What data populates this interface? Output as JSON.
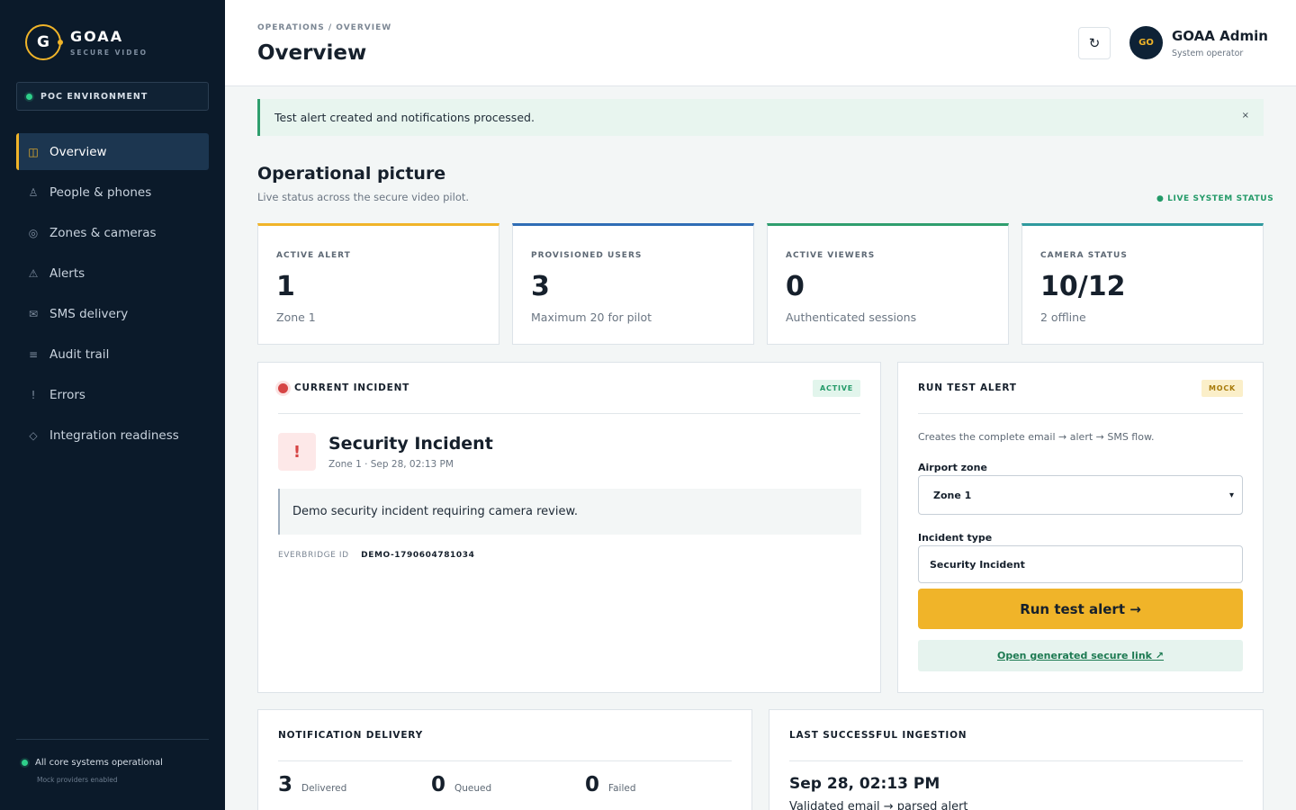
{
  "brand": {
    "mark": "G",
    "name": "GOAA",
    "sub": "SECURE VIDEO"
  },
  "environment": {
    "label": "POC ENVIRONMENT"
  },
  "nav": [
    {
      "label": "Overview",
      "icon": "◫"
    },
    {
      "label": "People & phones",
      "icon": "♙"
    },
    {
      "label": "Zones & cameras",
      "icon": "◎"
    },
    {
      "label": "Alerts",
      "icon": "⚠"
    },
    {
      "label": "SMS delivery",
      "icon": "✉"
    },
    {
      "label": "Audit trail",
      "icon": "≡"
    },
    {
      "label": "Errors",
      "icon": "!"
    },
    {
      "label": "Integration readiness",
      "icon": "◇"
    }
  ],
  "sidebar_footer": {
    "status": "All core systems operational",
    "note": "Mock providers enabled"
  },
  "header": {
    "breadcrumb": "OPERATIONS / OVERVIEW",
    "title": "Overview",
    "refresh_icon": "↻",
    "user": {
      "initials": "GO",
      "name": "GOAA Admin",
      "role": "System operator"
    }
  },
  "flash": {
    "message": "Test alert created and notifications processed.",
    "close": "×"
  },
  "section": {
    "title": "Operational picture",
    "subtitle": "Live status across the secure video pilot.",
    "live": "● LIVE SYSTEM STATUS"
  },
  "stats": [
    {
      "label": "ACTIVE ALERT",
      "value": "1",
      "note": "Zone 1",
      "color": "#f0b429"
    },
    {
      "label": "PROVISIONED USERS",
      "value": "3",
      "note": "Maximum 20 for pilot",
      "color": "#2f6db5"
    },
    {
      "label": "ACTIVE VIEWERS",
      "value": "0",
      "note": "Authenticated sessions",
      "color": "#2f9e6e"
    },
    {
      "label": "CAMERA STATUS",
      "value": "10/12",
      "note": "2 offline",
      "color": "#2f9a9e"
    }
  ],
  "incident": {
    "panel_title": "CURRENT INCIDENT",
    "badge": "ACTIVE",
    "icon": "!",
    "title": "Security Incident",
    "meta": "Zone 1 · Sep 28, 02:13 PM",
    "description": "Demo security incident requiring camera review.",
    "everbridge_label": "EVERBRIDGE ID",
    "everbridge_id": "DEMO-1790604781034"
  },
  "test_alert": {
    "panel_title": "RUN TEST ALERT",
    "badge": "MOCK",
    "description": "Creates the complete email → alert → SMS flow.",
    "zone_label": "Airport zone",
    "zone_value": "Zone 1",
    "type_label": "Incident type",
    "type_value": "Security Incident",
    "run_button": "Run test alert →",
    "open_link": "Open generated secure link ↗"
  },
  "notification": {
    "panel_title": "NOTIFICATION DELIVERY",
    "metrics": [
      {
        "value": "3",
        "label": "Delivered"
      },
      {
        "value": "0",
        "label": "Queued"
      },
      {
        "value": "0",
        "label": "Failed"
      }
    ]
  },
  "ingestion": {
    "panel_title": "LAST SUCCESSFUL INGESTION",
    "time": "Sep 28, 02:13 PM",
    "note": "Validated email → parsed alert"
  }
}
